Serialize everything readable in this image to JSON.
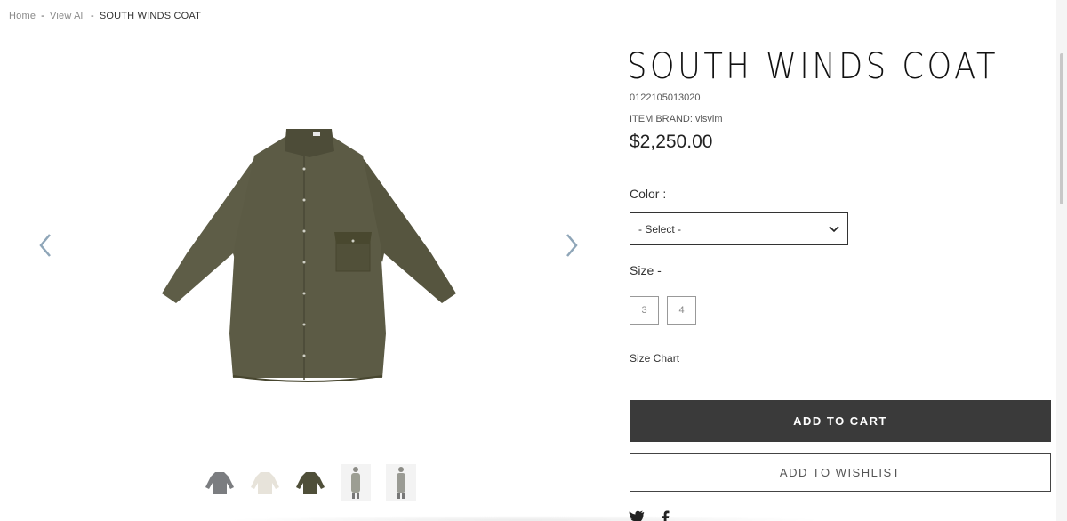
{
  "breadcrumb": {
    "home": "Home",
    "sep": "-",
    "view_all": "View All",
    "current": "SOUTH WINDS COAT"
  },
  "product": {
    "title": "SOUTH WINDS COAT",
    "sku": "0122105013020",
    "brand": "ITEM BRAND: visvim",
    "price": "$2,250.00",
    "coat_color": "#5c5b45"
  },
  "color": {
    "label": "Color :",
    "selected": "- Select -"
  },
  "size": {
    "label": "Size -",
    "options": [
      "3",
      "4"
    ]
  },
  "size_chart": "Size Chart",
  "buttons": {
    "add_to_cart": "ADD TO CART",
    "add_to_wishlist": "ADD TO WISHLIST"
  },
  "thumbnails": [
    {
      "name": "grey-coat",
      "color": "#7b7d80"
    },
    {
      "name": "white-coat",
      "color": "#e7e3da"
    },
    {
      "name": "olive-coat",
      "color": "#4f4f39"
    },
    {
      "name": "model-front",
      "color": "#9c9e93"
    },
    {
      "name": "model-back",
      "color": "#9a9b94"
    }
  ],
  "social": [
    "twitter-icon",
    "facebook-icon"
  ]
}
